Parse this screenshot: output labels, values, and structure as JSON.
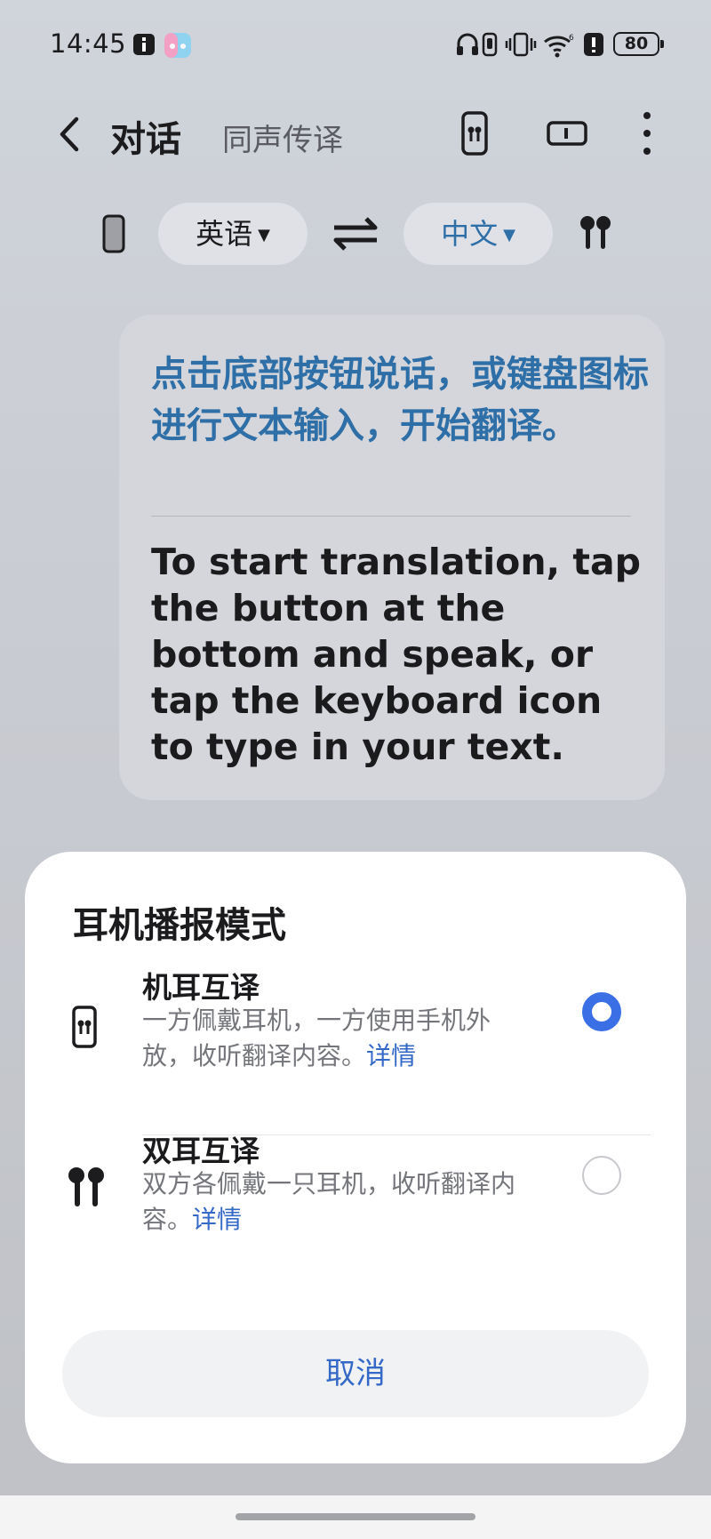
{
  "status_bar": {
    "time": "14:45",
    "battery": "80",
    "icons": [
      "notification-icon",
      "game-icon",
      "headphones-icon",
      "earbud-icon",
      "vibrate-icon",
      "wifi-icon",
      "alert-icon",
      "battery-icon"
    ]
  },
  "header": {
    "title": "对话",
    "subtitle": "同声传译",
    "icons": [
      "back-icon",
      "phone-earbud-icon",
      "split-screen-icon",
      "more-icon"
    ]
  },
  "language_bar": {
    "source_language": "英语",
    "target_language": "中文",
    "icons": [
      "phone-icon",
      "swap-icon",
      "earbuds-icon"
    ]
  },
  "card": {
    "chinese_text": "点击底部按钮说话，或键盘图标进行文本输入，开始翻译。",
    "english_text": "To start translation, tap the button at the bottom and speak, or tap the keyboard icon to type in your text."
  },
  "sheet": {
    "title": "耳机播报模式",
    "options": [
      {
        "title": "机耳互译",
        "description": "一方佩戴耳机，一方使用手机外放，收听翻译内容。",
        "link": "详情",
        "selected": true
      },
      {
        "title": "双耳互译",
        "description": "双方各佩戴一只耳机，收听翻译内容。",
        "link": "详情",
        "selected": false
      }
    ],
    "cancel_label": "取消"
  },
  "colors": {
    "accent": "#3b6fe6",
    "link": "#3569c8",
    "chinese_text": "#2f6fa7"
  }
}
